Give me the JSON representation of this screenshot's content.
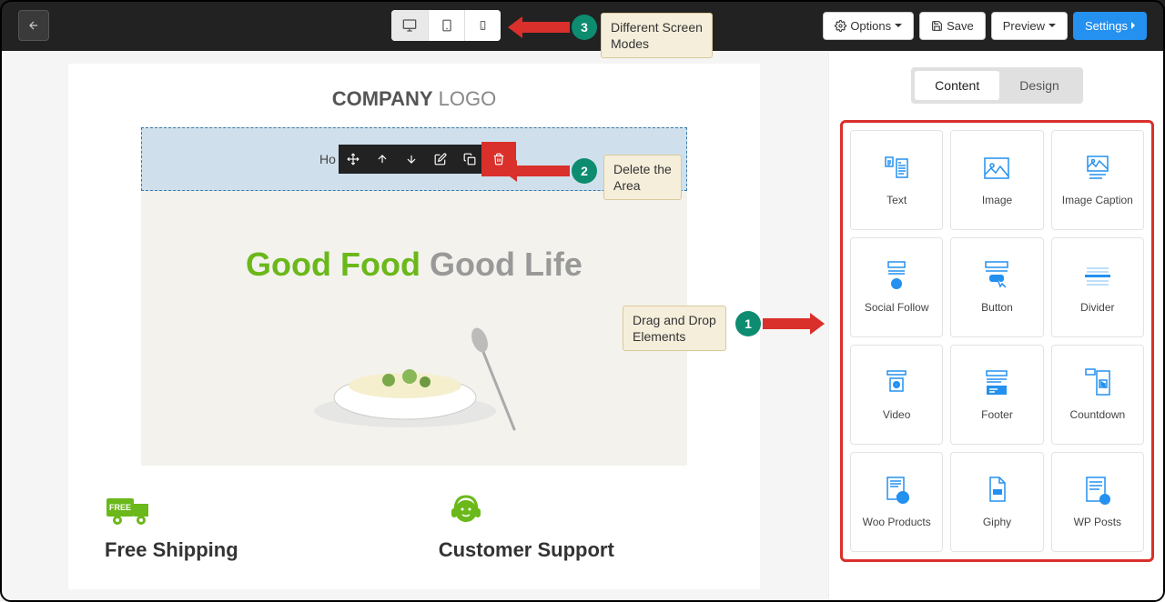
{
  "topbar": {
    "options_label": "Options",
    "save_label": "Save",
    "preview_label": "Preview",
    "settings_label": "Settings"
  },
  "callouts": {
    "screen_modes": "Different Screen\nModes",
    "delete_area": "Delete the\nArea",
    "drag_drop": "Drag and Drop\nElements"
  },
  "badges": {
    "n1": "1",
    "n2": "2",
    "n3": "3"
  },
  "canvas": {
    "logo_bold": "COMPANY",
    "logo_normal": " LOGO",
    "selected_text": "Ho",
    "hero_good_food": "Good Food ",
    "hero_good_life": "Good Life",
    "feat1": "Free Shipping",
    "feat2": "Customer Support"
  },
  "sidebar": {
    "tab_content": "Content",
    "tab_design": "Design",
    "elements": [
      "Text",
      "Image",
      "Image Caption",
      "Social Follow",
      "Button",
      "Divider",
      "Video",
      "Footer",
      "Countdown",
      "Woo Products",
      "Giphy",
      "WP Posts"
    ]
  }
}
